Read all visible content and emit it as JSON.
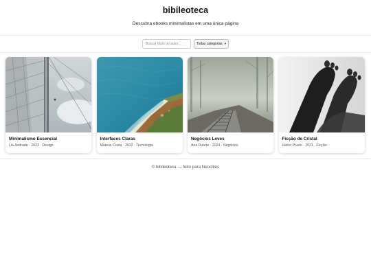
{
  "header": {
    "title": "bibileoteca",
    "tagline": "Descubra ebooks minimalistas em uma única página"
  },
  "filters": {
    "search_placeholder": "Buscar título ou autor...",
    "category_selected": "Todas categorias"
  },
  "books": [
    {
      "title": "Minimalismo Essencial",
      "meta": "Lia Andrade · 2023 · Design",
      "cover": "sailboat-sails-photo"
    },
    {
      "title": "Interfaces Claras",
      "meta": "Mateus Costa · 2022 · Tecnologia",
      "cover": "aerial-coast-photo"
    },
    {
      "title": "Negócios Leves",
      "meta": "Ana Duarte · 2024 · Negócios",
      "cover": "foggy-railroad-photo"
    },
    {
      "title": "Ficção de Cristal",
      "meta": "Heitor Prado · 2021 · Ficção",
      "cover": "bare-feet-bw-photo"
    }
  ],
  "footer": {
    "text": "© bibileoteca — feito para Neocities"
  }
}
